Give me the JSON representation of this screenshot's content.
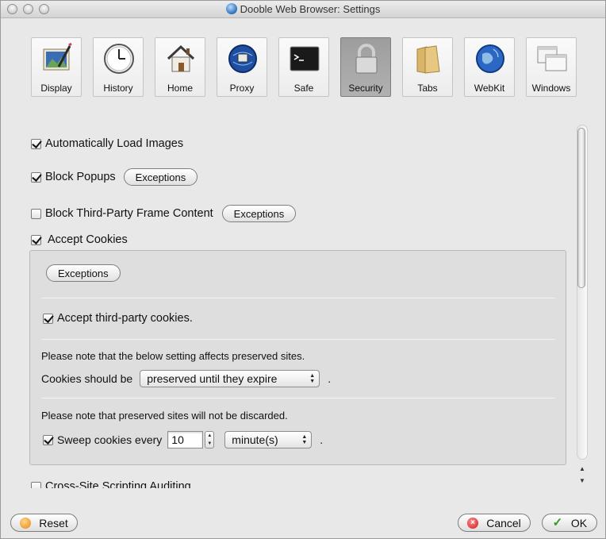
{
  "window": {
    "title": "Dooble Web Browser: Settings"
  },
  "toolbar": {
    "items": [
      {
        "label": "Display",
        "icon": "display-icon"
      },
      {
        "label": "History",
        "icon": "clock-icon"
      },
      {
        "label": "Home",
        "icon": "house-icon"
      },
      {
        "label": "Proxy",
        "icon": "globe-network-icon"
      },
      {
        "label": "Safe",
        "icon": "terminal-icon"
      },
      {
        "label": "Security",
        "icon": "padlock-icon",
        "selected": true
      },
      {
        "label": "Tabs",
        "icon": "folder-icon"
      },
      {
        "label": "WebKit",
        "icon": "globe-icon"
      },
      {
        "label": "Windows",
        "icon": "windows-icon"
      }
    ]
  },
  "security": {
    "auto_load_images": {
      "label": "Automatically Load Images",
      "checked": true
    },
    "block_popups": {
      "label": "Block Popups",
      "checked": true,
      "exceptions_label": "Exceptions"
    },
    "block_third_party_frames": {
      "label": "Block Third-Party Frame Content",
      "checked": false,
      "exceptions_label": "Exceptions"
    },
    "accept_cookies": {
      "label": "Accept Cookies",
      "checked": true
    },
    "cookies_group": {
      "exceptions_label": "Exceptions",
      "accept_third_party": {
        "label": "Accept third-party cookies.",
        "checked": true
      },
      "preserved_note": "Please note that the below setting affects preserved sites.",
      "cookies_should_be_label": "Cookies should be",
      "cookies_should_be_value": "preserved until they expire",
      "period": ".",
      "discard_note": "Please note that preserved sites will not be discarded.",
      "sweep": {
        "label": "Sweep cookies every",
        "checked": true,
        "value": "10",
        "unit": "minute(s)",
        "period": "."
      }
    },
    "xss_auditing": {
      "label": "Cross-Site Scripting Auditing",
      "checked": false
    }
  },
  "buttons": {
    "reset": "Reset",
    "cancel": "Cancel",
    "ok": "OK"
  }
}
